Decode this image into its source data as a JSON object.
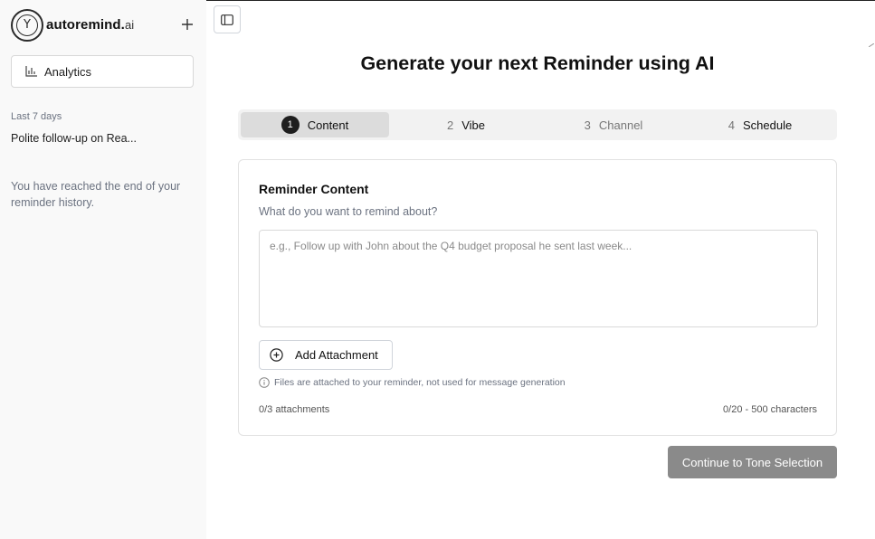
{
  "brand": {
    "name": "autoremind.",
    "suffix": "ai",
    "logo_letter": "Y"
  },
  "sidebar": {
    "new_icon": "plus-icon",
    "analytics_label": "Analytics",
    "analytics_icon": "bar-chart-icon",
    "section_label": "Last 7 days",
    "history_items": [
      {
        "label": "Polite follow-up on Rea..."
      }
    ],
    "end_note": "You have reached the end of your reminder history."
  },
  "header": {
    "toggle_icon": "sidebar-toggle-icon"
  },
  "main": {
    "title": "Generate your next Reminder using AI",
    "steps": [
      {
        "num": "1",
        "label": "Content",
        "active": true
      },
      {
        "num": "2",
        "label": "Vibe",
        "active": false
      },
      {
        "num": "3",
        "label": "Channel",
        "active": false
      },
      {
        "num": "4",
        "label": "Schedule",
        "active": false
      }
    ],
    "card": {
      "title": "Reminder Content",
      "subtitle": "What do you want to remind about?",
      "textarea_value": "",
      "textarea_placeholder": "e.g., Follow up with John about the Q4 budget proposal he sent last week...",
      "attach_label": "Add Attachment",
      "attach_icon": "plus-circle-icon",
      "info_icon": "info-icon",
      "info_text": "Files are attached to your reminder, not used for message generation",
      "attach_count": "0/3 attachments",
      "char_count": "0/20 - 500 characters"
    },
    "continue_label": "Continue to Tone Selection"
  },
  "colors": {
    "primary_dark": "#1f1f1f",
    "disabled_button": "#8a8a8a",
    "sidebar_bg": "#f9f9f9"
  }
}
